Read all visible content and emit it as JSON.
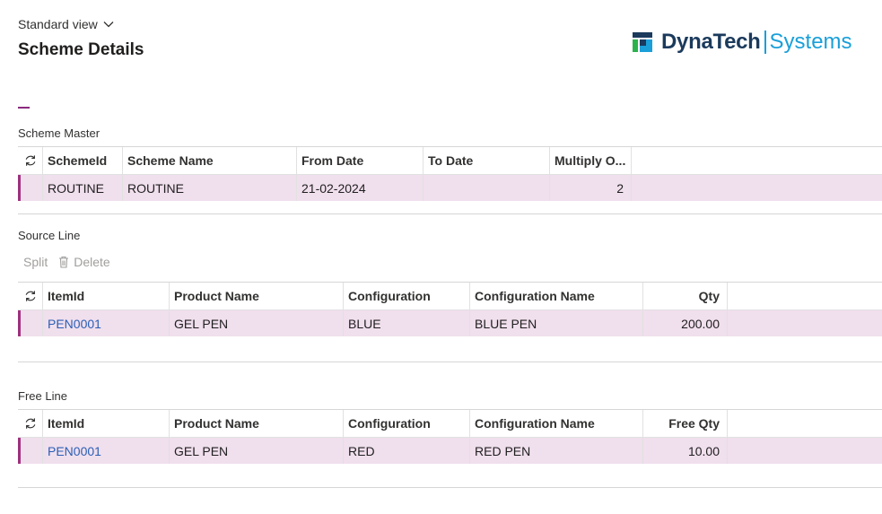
{
  "header": {
    "view_label": "Standard view",
    "page_title": "Scheme Details"
  },
  "logo": {
    "brand": "DynaTech",
    "sub": "Systems",
    "colors": {
      "brand": "#1b3a5c",
      "accent": "#1a9fd9"
    }
  },
  "scheme_master": {
    "label": "Scheme Master",
    "columns": [
      "SchemeId",
      "Scheme Name",
      "From Date",
      "To Date",
      "Multiply O..."
    ],
    "rows": [
      {
        "scheme_id": "ROUTINE",
        "scheme_name": "ROUTINE",
        "from_date": "21-02-2024",
        "to_date": "",
        "multiply": "2"
      }
    ]
  },
  "source_line": {
    "label": "Source Line",
    "actions": {
      "split": "Split",
      "delete": "Delete"
    },
    "columns": [
      "ItemId",
      "Product Name",
      "Configuration",
      "Configuration Name",
      "Qty"
    ],
    "rows": [
      {
        "item_id": "PEN0001",
        "product_name": "GEL PEN",
        "configuration": "BLUE",
        "configuration_name": "BLUE PEN",
        "qty": "200.00"
      }
    ]
  },
  "free_line": {
    "label": "Free Line",
    "columns": [
      "ItemId",
      "Product Name",
      "Configuration",
      "Configuration Name",
      "Free Qty"
    ],
    "rows": [
      {
        "item_id": "PEN0001",
        "product_name": "GEL PEN",
        "configuration": "RED",
        "configuration_name": "RED PEN",
        "qty": "10.00"
      }
    ]
  },
  "theme": {
    "selected_row": "#f0dfed",
    "row_accent": "#a0307e",
    "link": "#2b5fb5"
  }
}
